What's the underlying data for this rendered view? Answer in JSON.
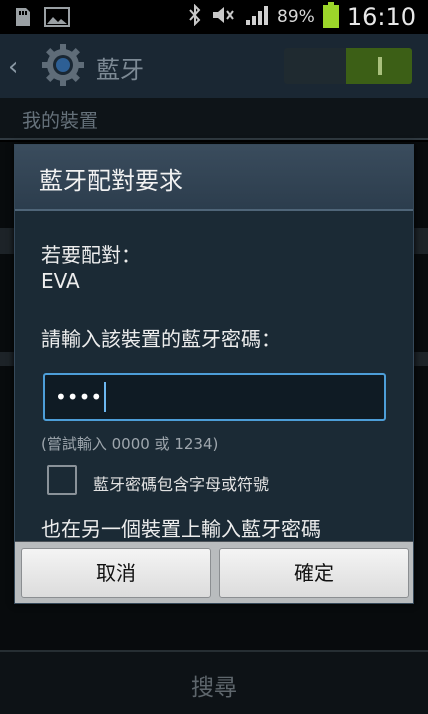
{
  "status_bar": {
    "battery_percent": "89%",
    "time": "16:10",
    "icons": [
      "sd-card-icon",
      "image-icon",
      "bluetooth-icon",
      "mute-icon",
      "signal-icon",
      "battery-icon"
    ]
  },
  "action_bar": {
    "title": "藍牙",
    "toggle_state": "on",
    "accent_color": "#3c5f16"
  },
  "section": {
    "header": "我的裝置"
  },
  "dialog": {
    "title": "藍牙配對要求",
    "pair_label": "若要配對：",
    "device_name": "EVA",
    "enter_label": "請輸入該裝置的藍牙密碼：",
    "pin_masked": "••••",
    "hint": "(嘗試輸入 0000 或 1234)",
    "checkbox_label": "藍牙密碼包含字母或符號",
    "checkbox_checked": false,
    "also_enter_label": "也在另一個裝置上輸入藍牙密碼",
    "cancel_label": "取消",
    "ok_label": "確定"
  },
  "bottom": {
    "search_label": "搜尋"
  }
}
